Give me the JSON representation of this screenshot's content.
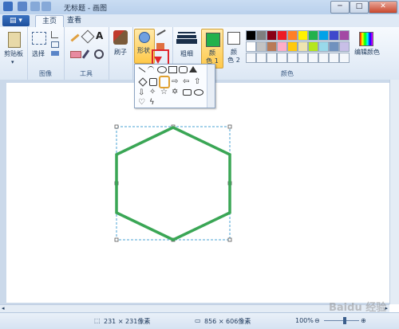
{
  "window": {
    "title": "无标题 - 画图",
    "minimize": "─",
    "maximize": "□",
    "close": "✕"
  },
  "tabs": [
    {
      "label": "主页"
    },
    {
      "label": "查看"
    }
  ],
  "app_button": {
    "label": "▤ ▾"
  },
  "ribbon": {
    "clipboard": {
      "paste_label": "剪贴板",
      "group_label": ""
    },
    "image": {
      "select_label": "选择",
      "group_label": "图像"
    },
    "tools": {
      "group_label": "工具",
      "text_glyph": "A"
    },
    "brush": {
      "label": "刷子"
    },
    "shapes": {
      "label": "形状"
    },
    "size": {
      "label": "粗细"
    },
    "color1": {
      "label": "颜色 1",
      "line1": "颜",
      "line2": "色 1"
    },
    "color2": {
      "label": "颜色 2",
      "line1": "颜",
      "line2": "色 2"
    },
    "colors": {
      "group_label": "颜色",
      "edit_label": "编辑颜色"
    },
    "palette_row1": [
      "#000000",
      "#7f7f7f",
      "#880015",
      "#ed1c24",
      "#ff7f27",
      "#fff200",
      "#22b14c",
      "#00a2e8",
      "#3f48cc",
      "#a349a4"
    ],
    "palette_row2": [
      "#ffffff",
      "#c3c3c3",
      "#b97a57",
      "#ffaec9",
      "#ffc90e",
      "#efe4b0",
      "#b5e61d",
      "#99d9ea",
      "#7092be",
      "#c8bfe7"
    ],
    "color1_value": "#22b14c",
    "color2_value": "#ffffff"
  },
  "dropdown": {
    "selected_shape": "hexagon"
  },
  "canvas": {
    "shape": "hexagon",
    "stroke_color": "#3aa655"
  },
  "status": {
    "selection_size": "231 × 231像素",
    "canvas_size": "856 × 606像素",
    "zoom": "100%"
  },
  "watermark": "Baidu 经验"
}
